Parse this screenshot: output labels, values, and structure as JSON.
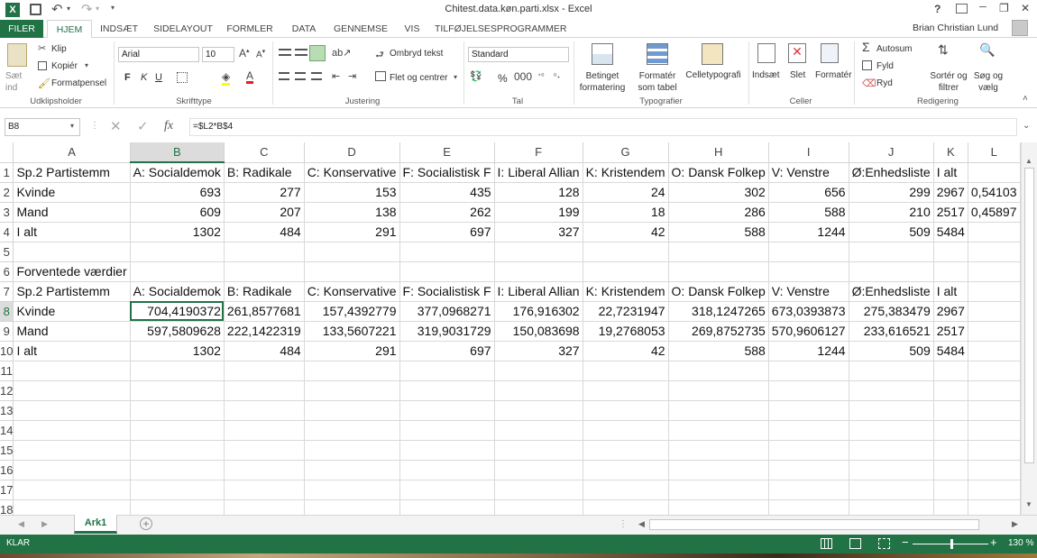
{
  "titlebar": {
    "title": "Chitest.data.køn.parti.xlsx - Excel",
    "help": "?",
    "minimize": "─",
    "restore": "❐",
    "close": "✕"
  },
  "tabs": [
    "FILER",
    "HJEM",
    "INDSÆT",
    "SIDELAYOUT",
    "FORMLER",
    "DATA",
    "GENNEMSE",
    "VIS",
    "TILFØJELSESPROGRAMMER"
  ],
  "user": "Brian Christian Lund",
  "ribbon": {
    "clipboard": {
      "paste": "Sæt ind",
      "cut": "Klip",
      "copy": "Kopiér",
      "format_painter": "Formatpensel",
      "label": "Udklipsholder"
    },
    "font": {
      "name": "Arial",
      "size": "10",
      "bold": "F",
      "italic": "K",
      "underline": "U",
      "label": "Skrifttype"
    },
    "alignment": {
      "wrap": "Ombryd tekst",
      "merge": "Flet og centrer",
      "label": "Justering"
    },
    "number": {
      "format": "Standard",
      "label": "Tal",
      "percent": "%"
    },
    "styles": {
      "cond": "Betinget formatering",
      "table": "Formatér som tabel",
      "cell": "Celletypografi",
      "label": "Typografier"
    },
    "cells": {
      "insert": "Indsæt",
      "delete": "Slet",
      "format": "Formatér",
      "label": "Celler"
    },
    "editing": {
      "autosum": "Autosum",
      "fill": "Fyld",
      "clear": "Ryd",
      "sort": "Sortér og filtrer",
      "find": "Søg og vælg",
      "label": "Redigering"
    }
  },
  "formula_bar": {
    "name_box": "B8",
    "fx": "fx",
    "formula": "=$L2*B$4"
  },
  "columns": [
    "A",
    "B",
    "C",
    "D",
    "E",
    "F",
    "G",
    "H",
    "I",
    "J",
    "K",
    "L"
  ],
  "rows": [
    {
      "n": "1",
      "cells": [
        "Sp.2 Partistemm",
        "A: Socialdemok",
        "B: Radikale",
        "C: Konservative",
        "F: Socialistisk F",
        "I: Liberal Allian",
        "K: Kristendem",
        "O: Dansk Folkep",
        "V: Venstre",
        "Ø:Enhedsliste",
        "I alt",
        ""
      ]
    },
    {
      "n": "2",
      "cells": [
        "Kvinde",
        "693",
        "277",
        "153",
        "435",
        "128",
        "24",
        "302",
        "656",
        "299",
        "2967",
        "0,54103"
      ]
    },
    {
      "n": "3",
      "cells": [
        "Mand",
        "609",
        "207",
        "138",
        "262",
        "199",
        "18",
        "286",
        "588",
        "210",
        "2517",
        "0,45897"
      ]
    },
    {
      "n": "4",
      "cells": [
        "I alt",
        "1302",
        "484",
        "291",
        "697",
        "327",
        "42",
        "588",
        "1244",
        "509",
        "5484",
        ""
      ]
    },
    {
      "n": "5",
      "cells": [
        "",
        "",
        "",
        "",
        "",
        "",
        "",
        "",
        "",
        "",
        "",
        ""
      ]
    },
    {
      "n": "6",
      "cells": [
        "Forventede værdier",
        "",
        "",
        "",
        "",
        "",
        "",
        "",
        "",
        "",
        "",
        ""
      ]
    },
    {
      "n": "7",
      "cells": [
        "Sp.2 Partistemm",
        "A: Socialdemok",
        "B: Radikale",
        "C: Konservative",
        "F: Socialistisk F",
        "I: Liberal Allian",
        "K: Kristendem",
        "O: Dansk Folkep",
        "V: Venstre",
        "Ø:Enhedsliste",
        "I alt",
        ""
      ]
    },
    {
      "n": "8",
      "cells": [
        "Kvinde",
        "704,4190372",
        "261,8577681",
        "157,4392779",
        "377,0968271",
        "176,916302",
        "22,7231947",
        "318,1247265",
        "673,0393873",
        "275,383479",
        "2967",
        ""
      ]
    },
    {
      "n": "9",
      "cells": [
        "Mand",
        "597,5809628",
        "222,1422319",
        "133,5607221",
        "319,9031729",
        "150,083698",
        "19,2768053",
        "269,8752735",
        "570,9606127",
        "233,616521",
        "2517",
        ""
      ]
    },
    {
      "n": "10",
      "cells": [
        "I alt",
        "1302",
        "484",
        "291",
        "697",
        "327",
        "42",
        "588",
        "1244",
        "509",
        "5484",
        ""
      ]
    },
    {
      "n": "11",
      "cells": [
        "",
        "",
        "",
        "",
        "",
        "",
        "",
        "",
        "",
        "",
        "",
        ""
      ]
    },
    {
      "n": "12",
      "cells": [
        "",
        "",
        "",
        "",
        "",
        "",
        "",
        "",
        "",
        "",
        "",
        ""
      ]
    },
    {
      "n": "13",
      "cells": [
        "",
        "",
        "",
        "",
        "",
        "",
        "",
        "",
        "",
        "",
        "",
        ""
      ]
    },
    {
      "n": "14",
      "cells": [
        "",
        "",
        "",
        "",
        "",
        "",
        "",
        "",
        "",
        "",
        "",
        ""
      ]
    },
    {
      "n": "15",
      "cells": [
        "",
        "",
        "",
        "",
        "",
        "",
        "",
        "",
        "",
        "",
        "",
        ""
      ]
    },
    {
      "n": "16",
      "cells": [
        "",
        "",
        "",
        "",
        "",
        "",
        "",
        "",
        "",
        "",
        "",
        ""
      ]
    },
    {
      "n": "17",
      "cells": [
        "",
        "",
        "",
        "",
        "",
        "",
        "",
        "",
        "",
        "",
        "",
        ""
      ]
    },
    {
      "n": "18",
      "cells": [
        "",
        "",
        "",
        "",
        "",
        "",
        "",
        "",
        "",
        "",
        "",
        ""
      ]
    }
  ],
  "sheet_tab": "Ark1",
  "status": {
    "mode": "KLAR",
    "zoom": "130 %"
  },
  "colors": {
    "excel_green": "#217346",
    "selection": "#217346"
  }
}
